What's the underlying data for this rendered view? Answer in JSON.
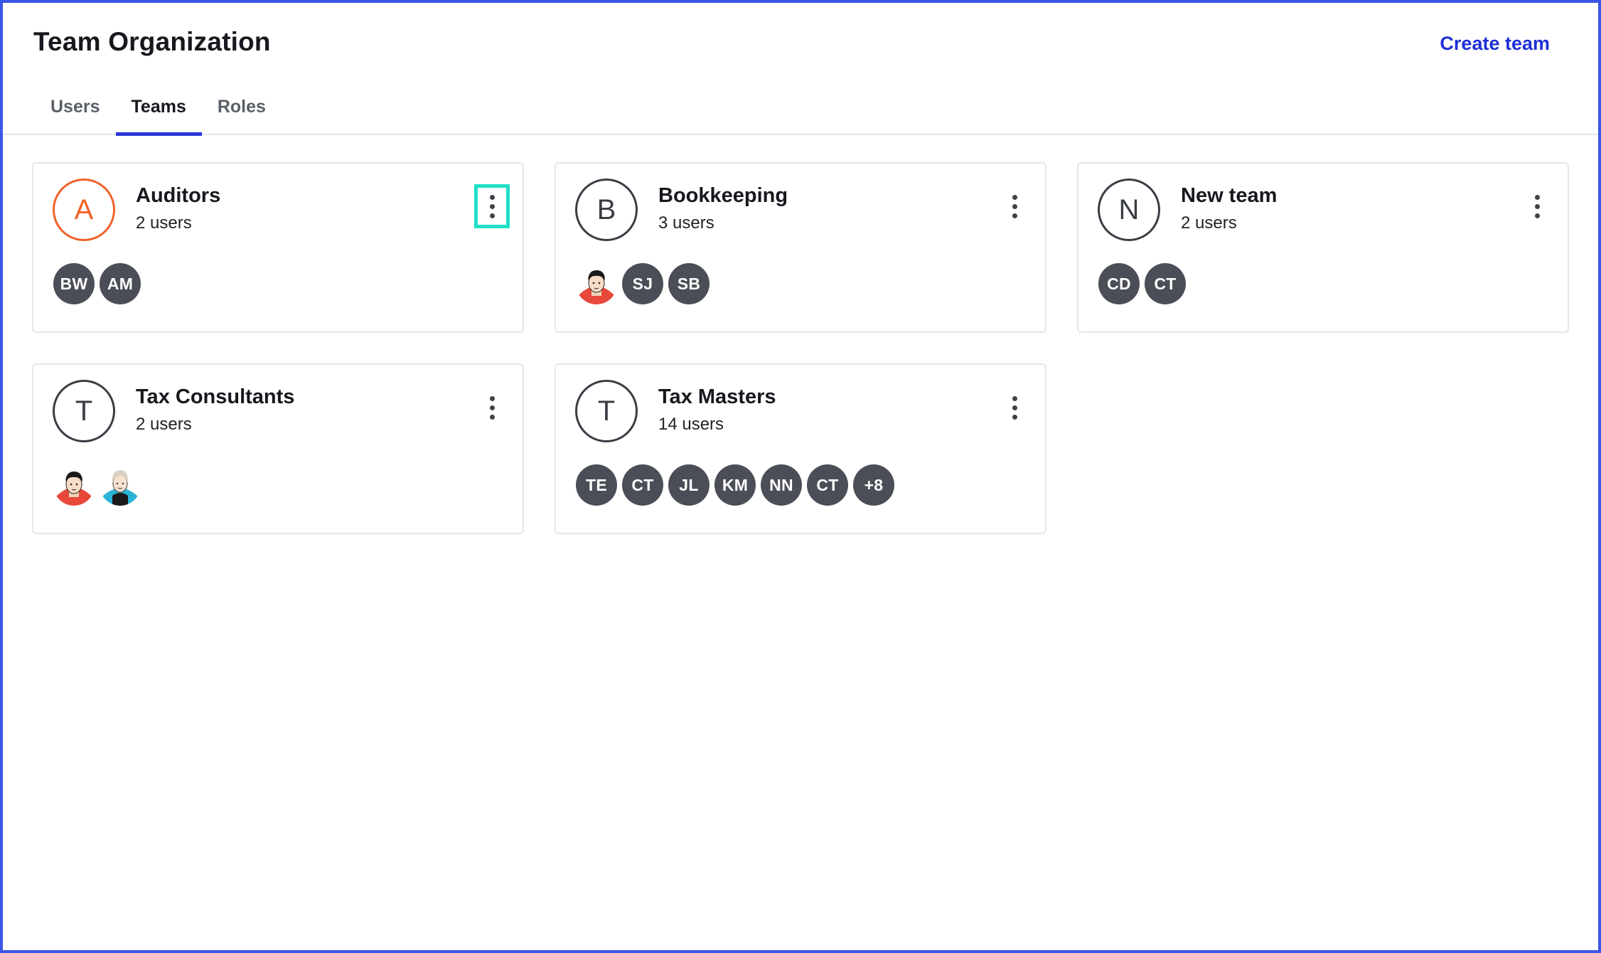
{
  "header": {
    "title": "Team Organization",
    "create_button": "Create team"
  },
  "tabs": [
    {
      "label": "Users",
      "active": false
    },
    {
      "label": "Teams",
      "active": true
    },
    {
      "label": "Roles",
      "active": false
    }
  ],
  "colors": {
    "accent": "#2a34d8",
    "link": "#1f2fd6",
    "focus_ring": "#1fe0c6",
    "auditors_avatar": "#f0622a",
    "member_badge": "#4b4e57"
  },
  "teams": [
    {
      "initial": "A",
      "name": "Auditors",
      "count": "2 users",
      "members": [
        {
          "type": "initials",
          "text": "BW"
        },
        {
          "type": "initials",
          "text": "AM"
        }
      ]
    },
    {
      "initial": "B",
      "name": "Bookkeeping",
      "count": "3 users",
      "members": [
        {
          "type": "photo",
          "icon": "user-photo-male"
        },
        {
          "type": "initials",
          "text": "SJ"
        },
        {
          "type": "initials",
          "text": "SB"
        }
      ]
    },
    {
      "initial": "N",
      "name": "New team",
      "count": "2 users",
      "members": [
        {
          "type": "initials",
          "text": "CD"
        },
        {
          "type": "initials",
          "text": "CT"
        }
      ]
    },
    {
      "initial": "T",
      "name": "Tax Consultants",
      "count": "2 users",
      "members": [
        {
          "type": "photo",
          "icon": "user-photo-male"
        },
        {
          "type": "photo",
          "icon": "user-photo-female"
        }
      ]
    },
    {
      "initial": "T",
      "name": "Tax Masters",
      "count": "14 users",
      "members": [
        {
          "type": "initials",
          "text": "TE"
        },
        {
          "type": "initials",
          "text": "CT"
        },
        {
          "type": "initials",
          "text": "JL"
        },
        {
          "type": "initials",
          "text": "KM"
        },
        {
          "type": "initials",
          "text": "NN"
        },
        {
          "type": "initials",
          "text": "CT"
        },
        {
          "type": "initials",
          "text": "+8"
        }
      ]
    }
  ]
}
